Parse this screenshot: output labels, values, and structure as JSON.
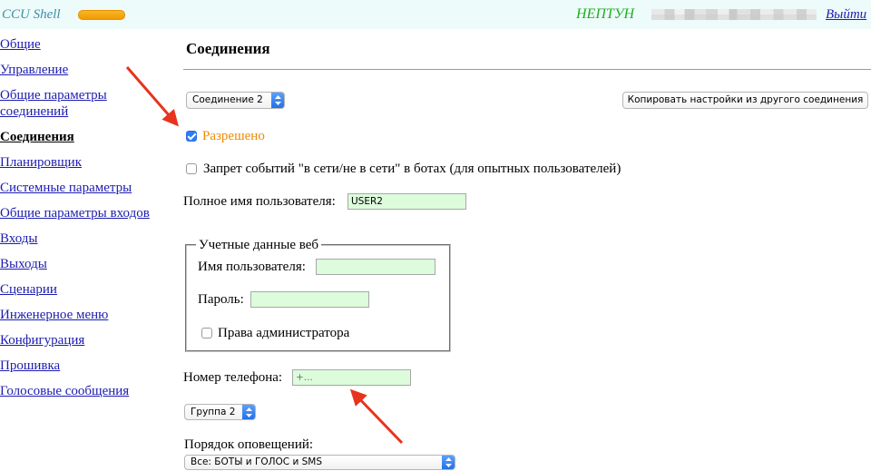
{
  "header": {
    "app_title": "CCU Shell",
    "device_name": "НЕПТУН",
    "logout_label": "Выйти"
  },
  "sidebar": {
    "items": [
      {
        "label": "Общие",
        "selected": false
      },
      {
        "label": "Управление",
        "selected": false
      },
      {
        "label": "Общие параметры соединений",
        "selected": false
      },
      {
        "label": "Соединения",
        "selected": true
      },
      {
        "label": "Планировщик",
        "selected": false
      },
      {
        "label": "Системные параметры",
        "selected": false
      },
      {
        "label": "Общие параметры входов",
        "selected": false
      },
      {
        "label": "Входы",
        "selected": false
      },
      {
        "label": "Выходы",
        "selected": false
      },
      {
        "label": "Сценарии",
        "selected": false
      },
      {
        "label": "Инженерное меню",
        "selected": false
      },
      {
        "label": "Конфигурация",
        "selected": false
      },
      {
        "label": "Прошивка",
        "selected": false
      },
      {
        "label": "Голосовые сообщения",
        "selected": false
      }
    ]
  },
  "main": {
    "title": "Соединения",
    "connection_select": {
      "value": "Соединение 2"
    },
    "copy_button_label": "Копировать настройки из другого соединения",
    "enabled": {
      "label": "Разрешено",
      "checked": true
    },
    "ban_events": {
      "label": "Запрет событий \"в сети/не в сети\" в ботах (для опытных пользователей)",
      "checked": false
    },
    "full_name": {
      "label": "Полное имя пользователя:",
      "value": "USER2"
    },
    "web_credentials": {
      "legend": "Учетные данные веб",
      "username_label": "Имя пользователя:",
      "username_value": "",
      "password_label": "Пароль:",
      "password_value": "",
      "admin": {
        "label": "Права администратора",
        "checked": false
      }
    },
    "phone": {
      "label": "Номер телефона:",
      "placeholder": "+...",
      "value": ""
    },
    "group_select": {
      "value": "Группа 2"
    },
    "notify_order": {
      "label": "Порядок оповещений:",
      "value": "Все: БОТЫ и ГОЛОС и SMS"
    }
  },
  "icons": {
    "select_arrows": "select-arrows-icon",
    "annotation": "arrow-annotation"
  },
  "colors": {
    "header_bg": "#eefbfb",
    "app_title": "#3f8fa6",
    "status_bar": "#f5a000",
    "device_name": "#1eae1e",
    "link": "#1c1cb0",
    "enabled_label": "#ee8a00",
    "input_bg": "#dcfcdc",
    "select_accent": "#2f7cf6",
    "annotation_arrow": "#e8331f"
  }
}
